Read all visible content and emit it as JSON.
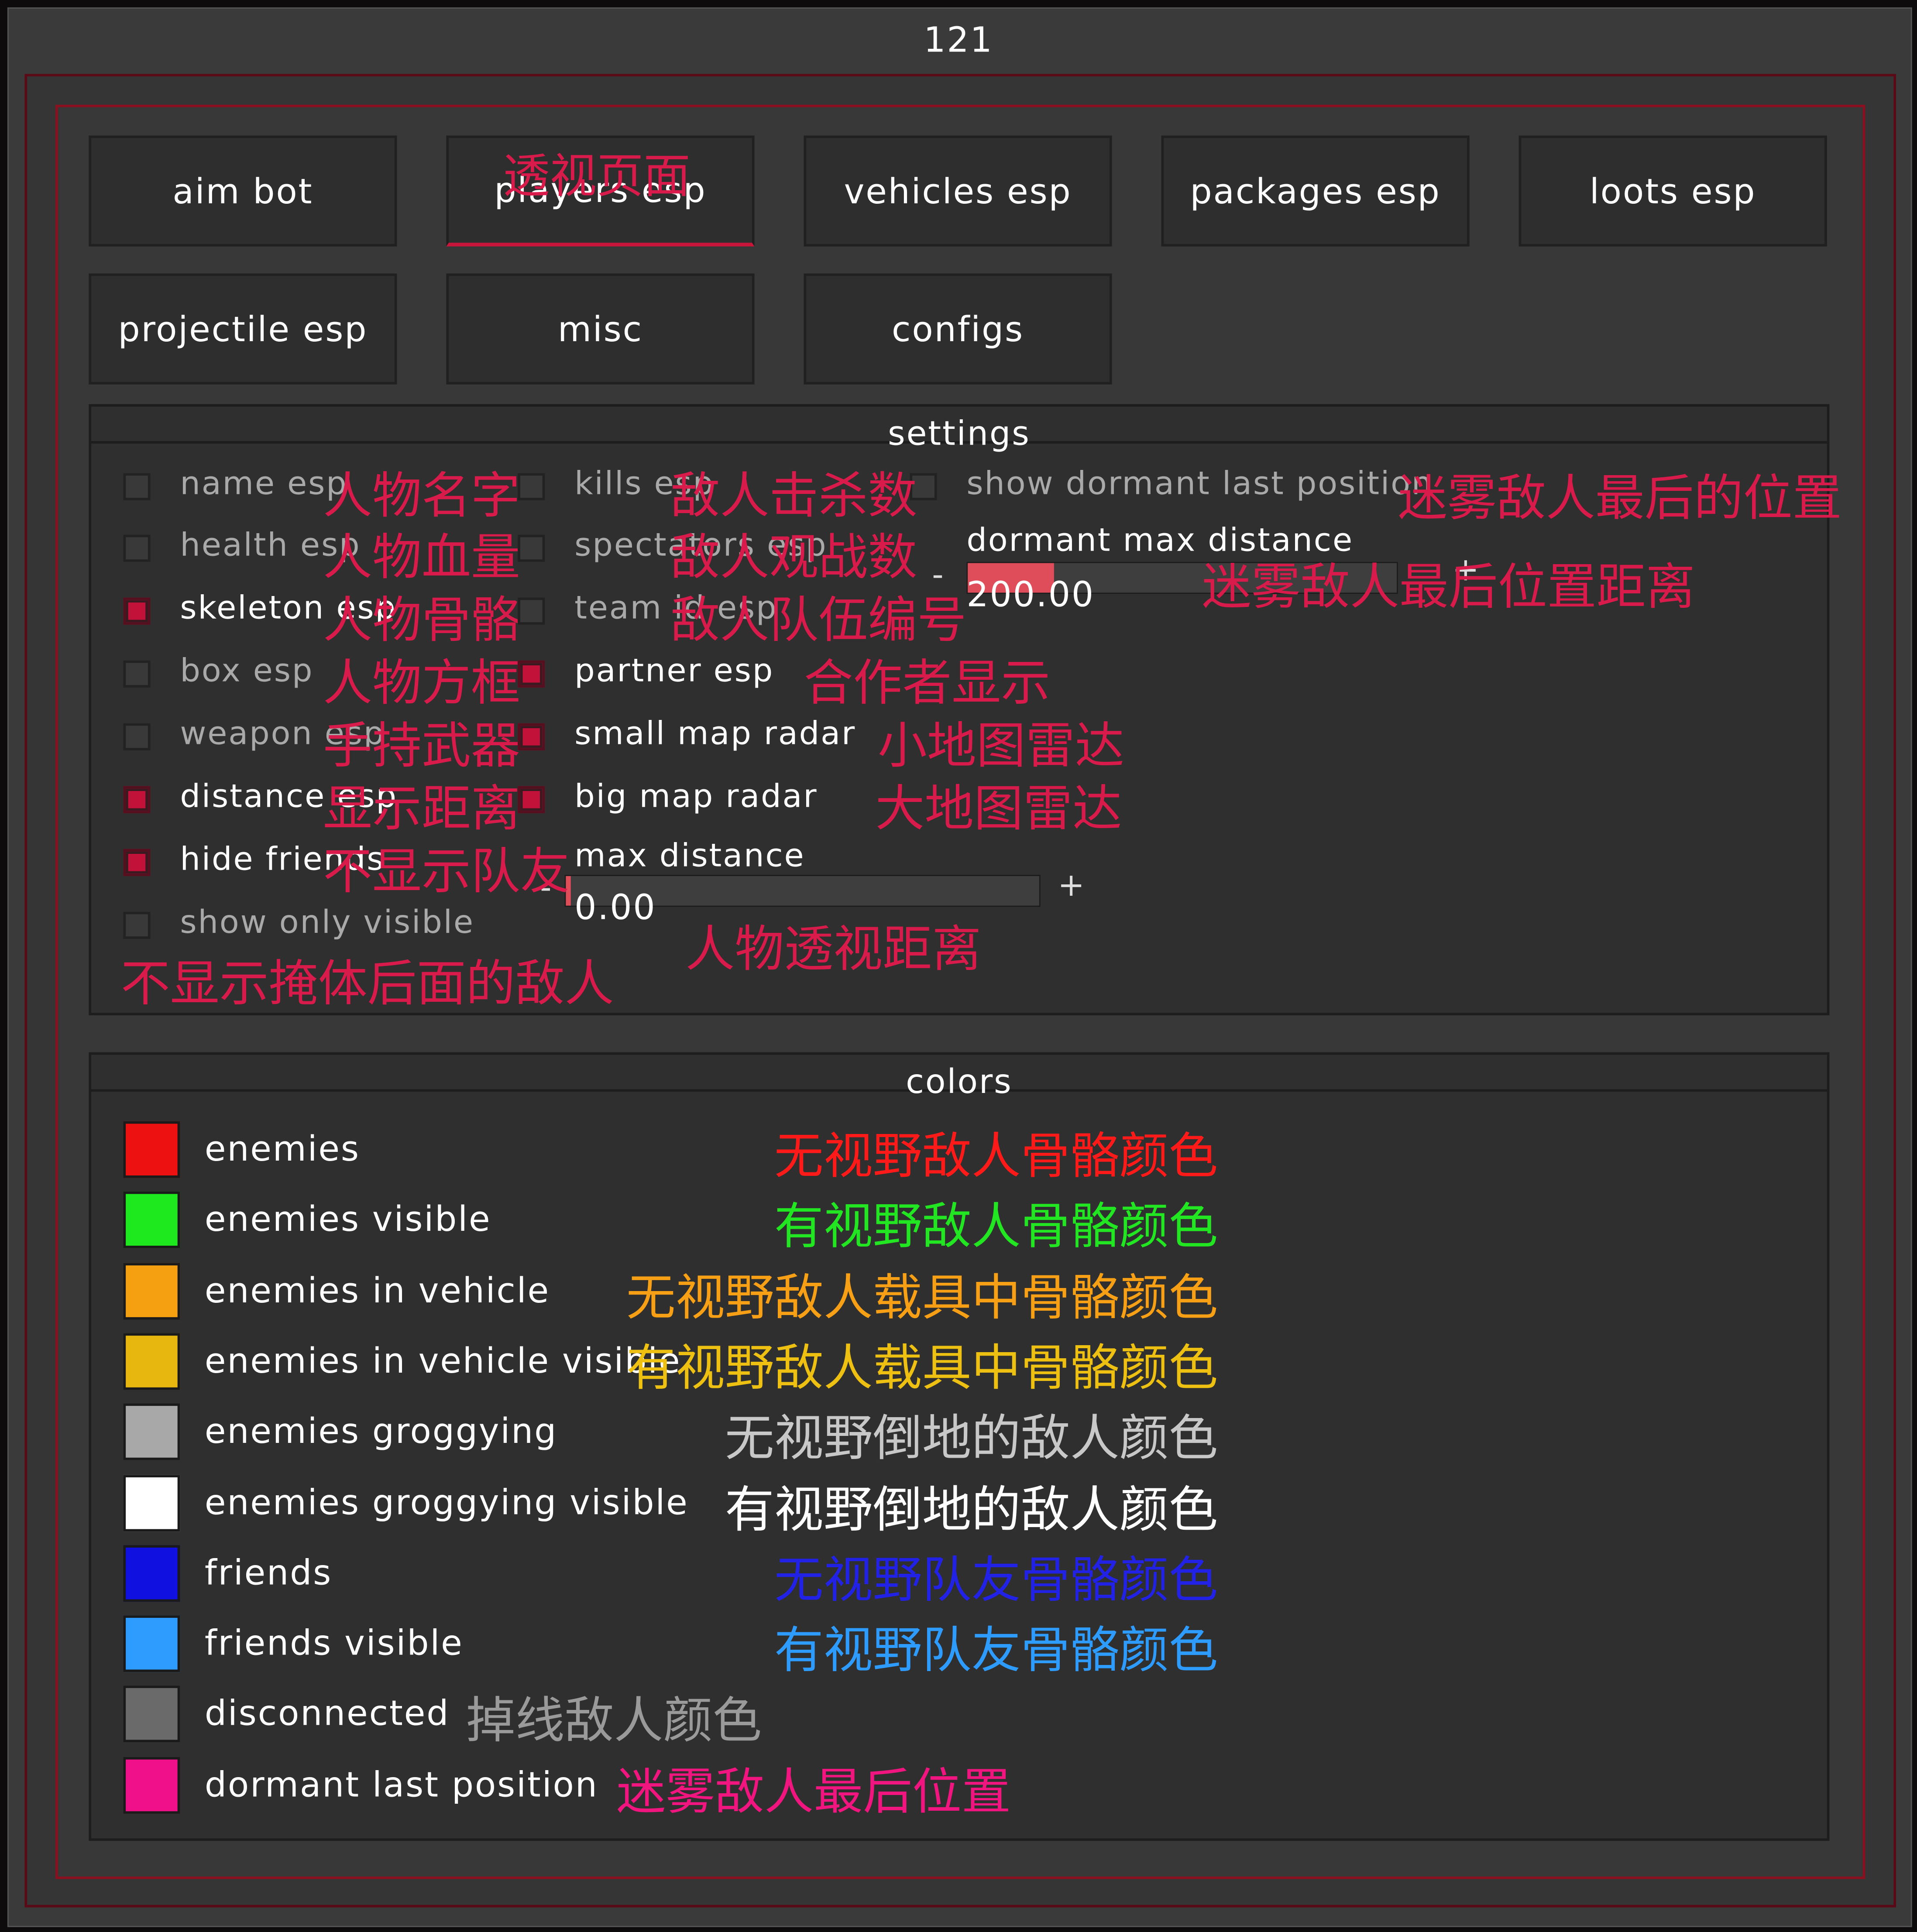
{
  "window": {
    "title": "121"
  },
  "tabs": [
    {
      "label": "aim bot"
    },
    {
      "label": "players esp",
      "annotation": "透视页面"
    },
    {
      "label": "vehicles esp"
    },
    {
      "label": "packages esp"
    },
    {
      "label": "loots esp"
    },
    {
      "label": "projectile esp"
    },
    {
      "label": "misc"
    },
    {
      "label": "configs"
    }
  ],
  "settings": {
    "title": "settings",
    "col1": [
      {
        "label": "name esp",
        "checked": false,
        "annotation": "人物名字"
      },
      {
        "label": "health esp",
        "checked": false,
        "annotation": "人物血量"
      },
      {
        "label": "skeleton esp",
        "checked": true,
        "annotation": "人物骨骼"
      },
      {
        "label": "box esp",
        "checked": false,
        "annotation": "人物方框"
      },
      {
        "label": "weapon esp",
        "checked": false,
        "annotation": "手持武器"
      },
      {
        "label": "distance esp",
        "checked": true,
        "annotation": "显示距离"
      },
      {
        "label": "hide friends",
        "checked": true,
        "annotation": "不显示队友"
      },
      {
        "label": "show only visible",
        "checked": false,
        "annotation": "不显示掩体后面的敌人"
      }
    ],
    "col2": [
      {
        "label": "kills esp",
        "checked": false,
        "annotation": "敌人击杀数"
      },
      {
        "label": "spectators esp",
        "checked": false,
        "annotation": "敌人观战数"
      },
      {
        "label": "team id esp",
        "checked": false,
        "annotation": "敌人队伍编号"
      },
      {
        "label": "partner esp",
        "checked": true,
        "annotation": "合作者显示"
      },
      {
        "label": "small map radar",
        "checked": true,
        "annotation": "小地图雷达"
      },
      {
        "label": "big map radar",
        "checked": true,
        "annotation": "大地图雷达"
      }
    ],
    "col3": {
      "checkbox": {
        "label": "show dormant last position",
        "checked": false,
        "annotation": "迷雾敌人最后的位置"
      },
      "slider": {
        "label": "dormant max distance",
        "value": "200.00",
        "fill_fraction": 0.2,
        "minus": "-",
        "plus": "+",
        "annotation": "迷雾敌人最后位置距离"
      }
    },
    "max_distance": {
      "label": "max distance",
      "value": "0.00",
      "fill_fraction": 0.0,
      "minus": "-",
      "plus": "+",
      "annotation": "人物透视距离"
    }
  },
  "colors": {
    "title": "colors",
    "items": [
      {
        "label": "enemies",
        "swatch": "#ee1111",
        "annotation": "无视野敌人骨骼颜色",
        "ann_color": "#ff1a1a"
      },
      {
        "label": "enemies visible",
        "swatch": "#1ee81e",
        "annotation": "有视野敌人骨骼颜色",
        "ann_color": "#22e622"
      },
      {
        "label": "enemies in vehicle",
        "swatch": "#f5a011",
        "annotation": "无视野敌人载具中骨骼颜色",
        "ann_color": "#f7a015"
      },
      {
        "label": "enemies in vehicle visible",
        "swatch": "#e8b70f",
        "annotation": "有视野敌人载具中骨骼颜色",
        "ann_color": "#eec012"
      },
      {
        "label": "enemies groggying",
        "swatch": "#a8a8a8",
        "annotation": "无视野倒地的敌人颜色",
        "ann_color": "#c8c8c8"
      },
      {
        "label": "enemies groggying visible",
        "swatch": "#ffffff",
        "annotation": "有视野倒地的敌人颜色",
        "ann_color": "#ffffff"
      },
      {
        "label": "friends",
        "swatch": "#1010e0",
        "annotation": "无视野队友骨骼颜色",
        "ann_color": "#2222e6"
      },
      {
        "label": "friends visible",
        "swatch": "#2e9cff",
        "annotation": "有视野队友骨骼颜色",
        "ann_color": "#2e9cff"
      },
      {
        "label": "disconnected",
        "swatch": "#6a6a6a",
        "annotation": "掉线敌人颜色",
        "ann_color": "#9a9a9a"
      },
      {
        "label": "dormant last position",
        "swatch": "#f0108a",
        "annotation": "迷雾敌人最后位置",
        "ann_color": "#f0157f"
      }
    ]
  }
}
